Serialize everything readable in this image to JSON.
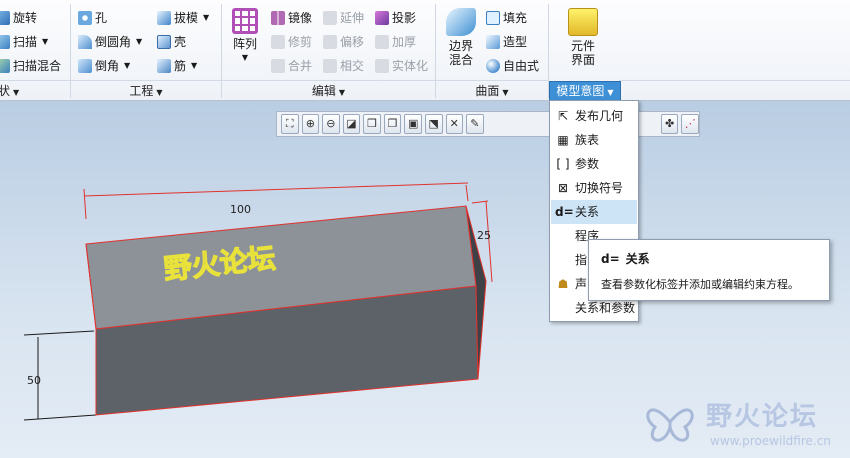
{
  "ribbon": {
    "shape_group": {
      "items": [
        "旋转",
        "扫描",
        "扫描混合"
      ],
      "label": "形状"
    },
    "engineering_group": {
      "col1": [
        "孔",
        "倒圆角",
        "倒角"
      ],
      "col2": [
        "拔模",
        "壳",
        "筋"
      ],
      "label": "工程"
    },
    "edit_group": {
      "pattern_label": "阵列",
      "col1": [
        "镜像",
        "修剪",
        "合并"
      ],
      "col2": [
        "延伸",
        "偏移",
        "相交"
      ],
      "col3": [
        "投影",
        "加厚",
        "实体化"
      ],
      "label": "编辑"
    },
    "surface_group": {
      "boundary_label_1": "边界",
      "boundary_label_2": "混合",
      "col": [
        "填充",
        "造型",
        "自由式"
      ],
      "label": "曲面"
    },
    "component_ui": {
      "label_1": "元件",
      "label_2": "界面"
    },
    "model_intent_label": "模型意图"
  },
  "dropdown": {
    "items": [
      "发布几何",
      "族表",
      "参数",
      "切换符号",
      "关系",
      "程序",
      "指",
      "声",
      "关系和参数"
    ],
    "active_index": 4
  },
  "tooltip": {
    "icon_text": "d=",
    "title": "关系",
    "description": "查看参数化标签并添加或编辑约束方程。"
  },
  "model": {
    "dim_length": "100",
    "dim_width": "25",
    "dim_height": "50",
    "embossed_text": "野火论坛"
  },
  "watermark": {
    "title": "野火论坛",
    "url": "www.proewildfire.cn"
  },
  "colors": {
    "accent": "#3d8fd6",
    "edge_highlight": "#e0322d",
    "embossed_text": "#e8e23a"
  }
}
